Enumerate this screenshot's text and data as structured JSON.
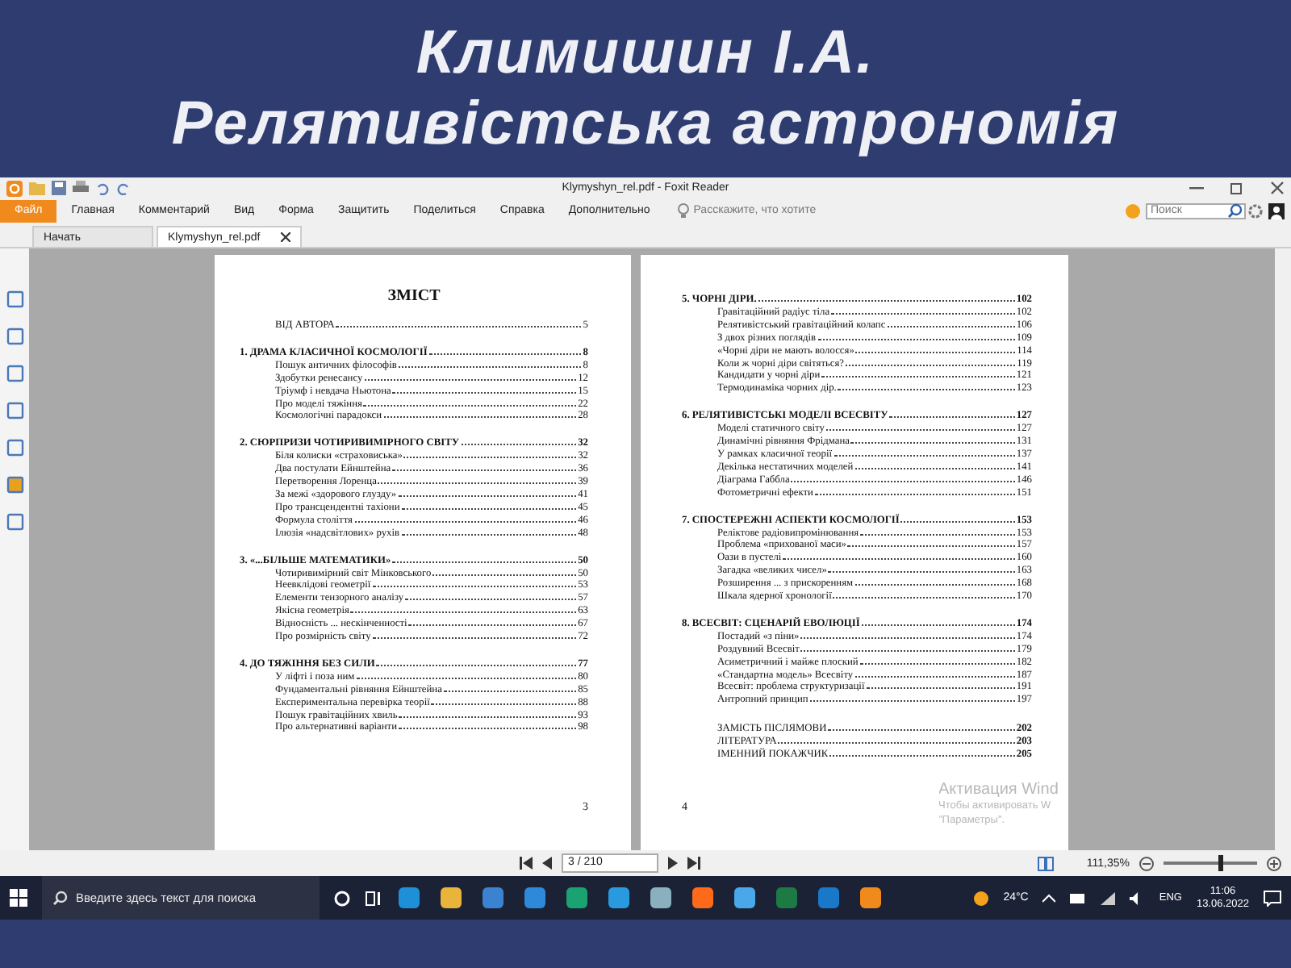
{
  "slide": {
    "title_lines": [
      "Климишин І.А.",
      "Релятивістська астрономія"
    ]
  },
  "window": {
    "title": "Klymyshyn_rel.pdf - Foxit Reader"
  },
  "menu": [
    {
      "label": "Файл",
      "selected": true
    },
    {
      "label": "Главная",
      "selected": false
    },
    {
      "label": "Комментарий",
      "selected": false
    },
    {
      "label": "Вид",
      "selected": false
    },
    {
      "label": "Форма",
      "selected": false
    },
    {
      "label": "Защитить",
      "selected": false
    },
    {
      "label": "Поделиться",
      "selected": false
    },
    {
      "label": "Справка",
      "selected": false
    },
    {
      "label": "Дополнительно",
      "selected": false
    }
  ],
  "tell_me": {
    "placeholder": "Расскажите, что хотите"
  },
  "search": {
    "placeholder": "Поиск"
  },
  "tabs": [
    {
      "label": "Начать",
      "selected": false
    },
    {
      "label": "Klymyshyn_rel.pdf",
      "selected": true
    }
  ],
  "pages": [
    {
      "heading": "ЗМІСТ",
      "page_number": "3",
      "entries": [
        {
          "kind": "front",
          "title": "ВІД АВТОРА",
          "page": "5"
        },
        {
          "kind": "chapter",
          "title": "1. ДРАМА КЛАСИЧНОЇ КОСМОЛОГІЇ",
          "page": "8",
          "children": [
            {
              "title": "Пошук античних філософів",
              "page": "8"
            },
            {
              "title": "Здобутки ренесансу",
              "page": "12"
            },
            {
              "title": "Тріумф і невдача Ньютона",
              "page": "15"
            },
            {
              "title": "Про моделі тяжіння",
              "page": "22"
            },
            {
              "title": "Космологічні парадокси",
              "page": "28"
            }
          ]
        },
        {
          "kind": "chapter",
          "title": "2. СЮРПРИЗИ ЧОТИРИВИМІРНОГО СВІТУ",
          "page": "32",
          "children": [
            {
              "title": "Біля колиски «страховиська»",
              "page": "32"
            },
            {
              "title": "Два постулати Ейнштейна",
              "page": "36"
            },
            {
              "title": "Перетворення Лоренца",
              "page": "39"
            },
            {
              "title": "За межі «здорового глузду»",
              "page": "41"
            },
            {
              "title": "Про трансцендентні тахіони",
              "page": "45"
            },
            {
              "title": "Формула століття",
              "page": "46"
            },
            {
              "title": "Ілюзія «надсвітлових» рухів",
              "page": "48"
            }
          ]
        },
        {
          "kind": "chapter",
          "title": "3. «...БІЛЬШЕ МАТЕМАТИКИ»",
          "page": "50",
          "children": [
            {
              "title": "Чотиривимірний світ Мінковського",
              "page": "50"
            },
            {
              "title": "Неевклідові геометрії",
              "page": "53"
            },
            {
              "title": "Елементи тензорного аналізу",
              "page": "57"
            },
            {
              "title": "Якісна геометрія",
              "page": "63"
            },
            {
              "title": "Відносність ... нескінченності",
              "page": "67"
            },
            {
              "title": "Про розмірність світу",
              "page": "72"
            }
          ]
        },
        {
          "kind": "chapter",
          "title": "4. ДО ТЯЖІННЯ БЕЗ СИЛИ",
          "page": "77",
          "children": [
            {
              "title": "У ліфті і поза ним",
              "page": "80"
            },
            {
              "title": "Фундаментальні рівняння Ейнштейна",
              "page": "85"
            },
            {
              "title": "Експериментальна перевірка теорії",
              "page": "88"
            },
            {
              "title": "Пошук гравітаційних хвиль",
              "page": "93"
            },
            {
              "title": "Про альтернативні варіанти",
              "page": "98"
            }
          ]
        }
      ]
    },
    {
      "page_number": "4",
      "entries": [
        {
          "kind": "chapter",
          "title": "5. ЧОРНІ ДІРИ.",
          "page": "102",
          "children": [
            {
              "title": "Гравітаційний радіус тіла",
              "page": "102"
            },
            {
              "title": "Релятивістський гравітаційний колапс",
              "page": "106"
            },
            {
              "title": "З двох різних поглядів",
              "page": "109"
            },
            {
              "title": "«Чорні діри не мають волосся»",
              "page": "114"
            },
            {
              "title": "Коли ж чорні діри світяться?",
              "page": "119"
            },
            {
              "title": "Кандидати у чорні діри",
              "page": "121"
            },
            {
              "title": "Термодинаміка чорних дір.",
              "page": "123"
            }
          ]
        },
        {
          "kind": "chapter",
          "title": "6. РЕЛЯТИВІСТСЬКІ МОДЕЛІ ВСЕСВІТУ",
          "page": "127",
          "children": [
            {
              "title": "Моделі статичного світу",
              "page": "127"
            },
            {
              "title": "Динамічні рівняння Фрідмана",
              "page": "131"
            },
            {
              "title": "У рамках класичної теорії",
              "page": "137"
            },
            {
              "title": "Декілька нестатичних моделей",
              "page": "141"
            },
            {
              "title": "Діаграма Габбла",
              "page": "146"
            },
            {
              "title": "Фотометричні ефекти",
              "page": "151"
            }
          ]
        },
        {
          "kind": "chapter",
          "title": "7. СПОСТЕРЕЖНІ АСПЕКТИ КОСМОЛОГІЇ",
          "page": "153",
          "children": [
            {
              "title": "Реліктове радіовипромінювання",
              "page": "153"
            },
            {
              "title": "Проблема «прихованої маси»",
              "page": "157"
            },
            {
              "title": "Оази в пустелі",
              "page": "160"
            },
            {
              "title": "Загадка «великих чисел»",
              "page": "163"
            },
            {
              "title": "Розширення ... з прискоренням",
              "page": "168"
            },
            {
              "title": "Шкала ядерної хронології",
              "page": "170"
            }
          ]
        },
        {
          "kind": "chapter",
          "title": "8. ВСЕСВІТ: СЦЕНАРІЙ ЕВОЛЮЦІЇ",
          "page": "174",
          "children": [
            {
              "title": "Постадий «з піни»",
              "page": "174"
            },
            {
              "title": "Роздувний Всесвіт",
              "page": "179"
            },
            {
              "title": "Асиметричний і майже плоский",
              "page": "182"
            },
            {
              "title": "«Стандартна модель» Всесвіту",
              "page": "187"
            },
            {
              "title": "Всесвіт: проблема структуризації",
              "page": "191"
            },
            {
              "title": "Антропний принцип",
              "page": "197"
            }
          ]
        },
        {
          "kind": "back",
          "title": "ЗАМІСТЬ ПІСЛЯМОВИ",
          "page": "202"
        },
        {
          "kind": "back",
          "title": "ЛІТЕРАТУРА",
          "page": "203"
        },
        {
          "kind": "back",
          "title": "ІМЕННИЙ ПОКАЖЧИК",
          "page": "205"
        }
      ]
    }
  ],
  "activation": {
    "title": "Активация Wind",
    "lines": [
      "Чтобы активировать W",
      "\"Параметры\"."
    ]
  },
  "status_bar": {
    "page_field": "3 / 210",
    "zoom": "111,35%",
    "zoom_slider": {
      "level": 0.6
    }
  },
  "taskbar": {
    "search_placeholder": "Введите здесь текст для поиска",
    "weather": "24°C",
    "language": "ENG",
    "time": "11:06",
    "date": "13.06.2022"
  }
}
